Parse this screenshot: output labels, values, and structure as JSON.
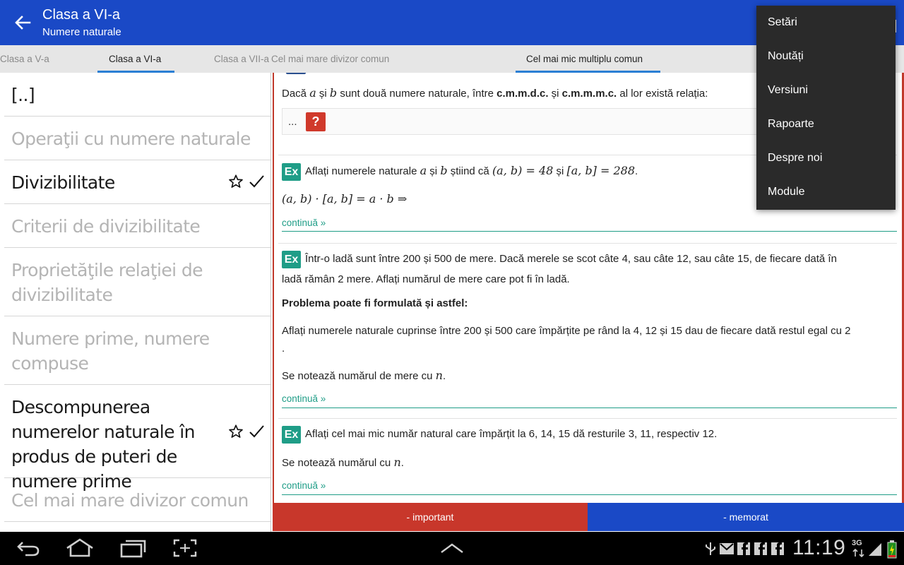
{
  "actionbar": {
    "title": "Clasa a VI-a",
    "subtitle": "Numere naturale"
  },
  "tabs": [
    {
      "label": "Clasa a V-a",
      "active": false
    },
    {
      "label": "Clasa a VI-a",
      "active": true
    },
    {
      "label": "Clasa a VII-a",
      "active": false
    },
    {
      "label": "Cel mai mare divizor comun",
      "active": false
    },
    {
      "label": "Cel mai mic multiplu comun",
      "active": true
    }
  ],
  "sidebar": {
    "items": [
      {
        "label": "[..]",
        "enabled": true
      },
      {
        "label": "Operaţii cu numere naturale",
        "enabled": false
      },
      {
        "label": "Divizibilitate",
        "enabled": true,
        "starred": true,
        "done": true
      },
      {
        "label": "Criterii de divizibilitate",
        "enabled": false
      },
      {
        "label": "Proprietăţile relaţiei de divizibilitate",
        "enabled": false
      },
      {
        "label": "Numere prime, numere compuse",
        "enabled": false
      },
      {
        "label": "Descompunerea numerelor naturale în produs de puteri de numere prime",
        "enabled": true,
        "starred": true,
        "done": true
      },
      {
        "label": "Cel mai mare divizor comun",
        "enabled": false
      }
    ]
  },
  "content": {
    "card1": {
      "text_pre": "Dacă ",
      "var_a": "a",
      "text_and": " și ",
      "var_b": "b",
      "text_mid": " sunt două numere naturale, între ",
      "bold1": "c.m.m.d.c.",
      "text_and2": " și ",
      "bold2": "c.m.m.m.c.",
      "text_post": " al lor există relația:",
      "dots": "...",
      "qmark": "?"
    },
    "card2": {
      "badge": "Ex",
      "text_pre": "Aflați numerele naturale ",
      "var_a": "a",
      "text_and": " și ",
      "var_b": "b",
      "text_mid": " știind că ",
      "eq1": "(a, b) = 48",
      "text_and2": " și ",
      "eq2": "[a, b] = 288",
      "text_end": ".",
      "formula": "(a, b) · [a, b] = a · b ⇒",
      "more": "continuă »"
    },
    "card3": {
      "badge": "Ex",
      "line1": "Într-o ladă sunt între 200 și 500 de mere. Dacă merele se scot câte 4, sau câte 12, sau câte 15, de fiecare dată în",
      "line2": "ladă rămân 2 mere. Aflați numărul de mere care pot fi în ladă.",
      "bold_line": "Problema poate fi formulată și astfel:",
      "line3": "Aflați numerele naturale cuprinse între 200 și 500 care împărțite pe rând la 4, 12 și 15 dau de fiecare dată restul egal cu 2",
      "line3b": ".",
      "line4_pre": "Se notează numărul de mere cu ",
      "line4_var": "n",
      "line4_post": ".",
      "more": "continuă »"
    },
    "card4": {
      "badge": "Ex",
      "line1": "Aflați cel mai mic număr natural care împărțit la 6, 14, 15 dă resturile 3, 11, respectiv 12.",
      "line2_pre": "Se notează numărul cu ",
      "line2_var": "n",
      "line2_post": ".",
      "more": "continuă »"
    }
  },
  "buttons": {
    "important": "- important",
    "memorat": "- memorat"
  },
  "menu": {
    "items": [
      "Setări",
      "Noutăți",
      "Versiuni",
      "Rapoarte",
      "Despre noi",
      "Module"
    ]
  },
  "statusbar": {
    "time": "11:19",
    "network": "3G"
  },
  "colors": {
    "primary": "#1a49c6",
    "accent": "#1f9d87",
    "important": "#c8372b",
    "tab_indicator": "#2a7fd4"
  }
}
